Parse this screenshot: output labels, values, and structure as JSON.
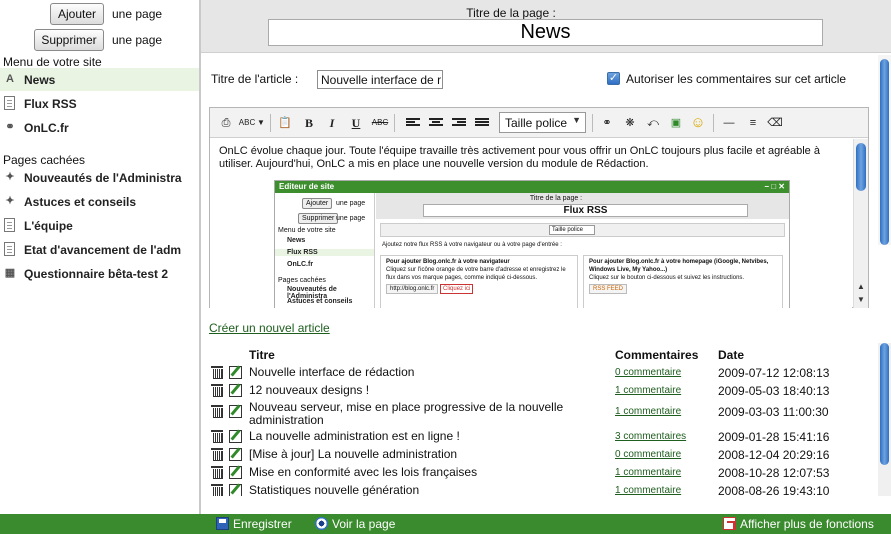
{
  "sidebar": {
    "add_button": "Ajouter",
    "add_suffix": "une page",
    "delete_button": "Supprimer",
    "delete_suffix": "une page",
    "menu_title": "Menu de votre site",
    "menu_items": [
      {
        "label": "News",
        "icon": "text-page-icon",
        "active": true
      },
      {
        "label": "Flux RSS",
        "icon": "document-icon"
      },
      {
        "label": "OnLC.fr",
        "icon": "link-icon"
      }
    ],
    "hidden_title": "Pages cachées",
    "hidden_items": [
      {
        "label": "Nouveautés de l'Administra",
        "icon": "tag-icon"
      },
      {
        "label": "Astuces et conseils",
        "icon": "tag-icon"
      },
      {
        "label": "L'équipe",
        "icon": "document-icon"
      },
      {
        "label": "Etat d'avancement de l'adm",
        "icon": "document-icon"
      },
      {
        "label": "Questionnaire bêta-test 2",
        "icon": "form-icon"
      }
    ]
  },
  "page": {
    "title_label": "Titre de la page :",
    "title_value": "News"
  },
  "article": {
    "title_label": "Titre de l'article :",
    "title_value": "Nouvelle interface de r",
    "allow_comments_label": "Autoriser les commentaires sur cet article",
    "allow_comments_checked": true
  },
  "editor": {
    "font_size_label": "Taille police",
    "body_text": "OnLC évolue chaque jour. Toute l'équipe travaille très activement pour vous offrir un OnLC toujours plus facile et agréable à utiliser. Aujourd'hui, OnLC a mis en place une nouvelle version du module de Rédaction.",
    "embedded": {
      "window_title": "Editeur de site",
      "add_button": "Ajouter",
      "delete_button": "Supprimer",
      "suffix": "une page",
      "menu_title": "Menu de votre site",
      "items": [
        "News",
        "Flux RSS",
        "OnLC.fr"
      ],
      "hidden_title": "Pages cachées",
      "hidden_items": [
        "Nouveautés de l'Administra",
        "Astuces et conseils"
      ],
      "title_label": "Titre de la page :",
      "title_value": "Flux RSS",
      "font_size": "Taille police",
      "intro": "Ajoutez notre flux RSS à votre navigateur ou à votre page d'entrée :",
      "box1_title": "Pour ajouter Blog.onlc.fr à votre navigateur",
      "box1_text": "Cliquez sur l'icône orange de votre barre d'adresse et enregistrez le flux dans vos marque pages, comme indiqué ci-dessous.",
      "box1_url": "http://blog.onlc.fr",
      "box1_hint": "Cliquez ici",
      "box2_title": "Pour ajouter Blog.onlc.fr à votre homepage (iGoogle, Netvibes, Windows Live, My Yahoo...)",
      "box2_text": "Cliquez sur le bouton ci-dessous et suivez les instructions.",
      "box2_button": "RSS FEED"
    }
  },
  "articles": {
    "create_link": "Créer un nouvel article",
    "headers": {
      "title": "Titre",
      "comments": "Commentaires",
      "date": "Date"
    },
    "rows": [
      {
        "title": "Nouvelle interface de rédaction",
        "comments": "0 commentaire",
        "date": "2009-07-12 12:08:13"
      },
      {
        "title": "12 nouveaux designs !",
        "comments": "1 commentaire",
        "date": "2009-05-03 18:40:13"
      },
      {
        "title": "Nouveau serveur, mise en place progressive de la nouvelle administration",
        "comments": "1 commentaire",
        "date": "2009-03-03 11:00:30"
      },
      {
        "title": "La nouvelle administration est en ligne !",
        "comments": "3 commentaires",
        "date": "2009-01-28 15:41:16"
      },
      {
        "title": "[Mise à jour] La nouvelle administration",
        "comments": "0 commentaire",
        "date": "2008-12-04 20:29:16"
      },
      {
        "title": "Mise en conformité avec les lois françaises",
        "comments": "1 commentaire",
        "date": "2008-10-28 12:07:53"
      },
      {
        "title": "Statistiques nouvelle génération",
        "comments": "1 commentaire",
        "date": "2008-08-26 19:43:10"
      }
    ]
  },
  "bottom_bar": {
    "save": "Enregistrer",
    "view": "Voir la page",
    "more": "Afficher plus de fonctions"
  },
  "colors": {
    "accent_green": "#3a8a2e",
    "link_green": "#1e5e1e",
    "active_item_bg": "#e9f4e3",
    "scroll_blue": "#2e6fc4"
  }
}
